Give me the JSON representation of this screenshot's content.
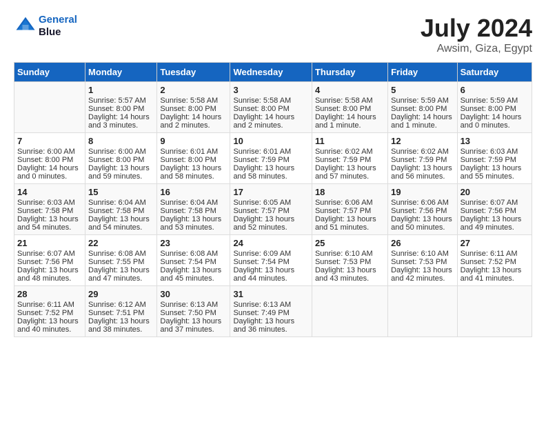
{
  "header": {
    "logo_line1": "General",
    "logo_line2": "Blue",
    "title": "July 2024",
    "subtitle": "Awsim, Giza, Egypt"
  },
  "calendar": {
    "days_of_week": [
      "Sunday",
      "Monday",
      "Tuesday",
      "Wednesday",
      "Thursday",
      "Friday",
      "Saturday"
    ],
    "weeks": [
      [
        {
          "day": "",
          "sunrise": "",
          "sunset": "",
          "daylight": ""
        },
        {
          "day": "1",
          "sunrise": "Sunrise: 5:57 AM",
          "sunset": "Sunset: 8:00 PM",
          "daylight": "Daylight: 14 hours and 3 minutes."
        },
        {
          "day": "2",
          "sunrise": "Sunrise: 5:58 AM",
          "sunset": "Sunset: 8:00 PM",
          "daylight": "Daylight: 14 hours and 2 minutes."
        },
        {
          "day": "3",
          "sunrise": "Sunrise: 5:58 AM",
          "sunset": "Sunset: 8:00 PM",
          "daylight": "Daylight: 14 hours and 2 minutes."
        },
        {
          "day": "4",
          "sunrise": "Sunrise: 5:58 AM",
          "sunset": "Sunset: 8:00 PM",
          "daylight": "Daylight: 14 hours and 1 minute."
        },
        {
          "day": "5",
          "sunrise": "Sunrise: 5:59 AM",
          "sunset": "Sunset: 8:00 PM",
          "daylight": "Daylight: 14 hours and 1 minute."
        },
        {
          "day": "6",
          "sunrise": "Sunrise: 5:59 AM",
          "sunset": "Sunset: 8:00 PM",
          "daylight": "Daylight: 14 hours and 0 minutes."
        }
      ],
      [
        {
          "day": "7",
          "sunrise": "Sunrise: 6:00 AM",
          "sunset": "Sunset: 8:00 PM",
          "daylight": "Daylight: 14 hours and 0 minutes."
        },
        {
          "day": "8",
          "sunrise": "Sunrise: 6:00 AM",
          "sunset": "Sunset: 8:00 PM",
          "daylight": "Daylight: 13 hours and 59 minutes."
        },
        {
          "day": "9",
          "sunrise": "Sunrise: 6:01 AM",
          "sunset": "Sunset: 8:00 PM",
          "daylight": "Daylight: 13 hours and 58 minutes."
        },
        {
          "day": "10",
          "sunrise": "Sunrise: 6:01 AM",
          "sunset": "Sunset: 7:59 PM",
          "daylight": "Daylight: 13 hours and 58 minutes."
        },
        {
          "day": "11",
          "sunrise": "Sunrise: 6:02 AM",
          "sunset": "Sunset: 7:59 PM",
          "daylight": "Daylight: 13 hours and 57 minutes."
        },
        {
          "day": "12",
          "sunrise": "Sunrise: 6:02 AM",
          "sunset": "Sunset: 7:59 PM",
          "daylight": "Daylight: 13 hours and 56 minutes."
        },
        {
          "day": "13",
          "sunrise": "Sunrise: 6:03 AM",
          "sunset": "Sunset: 7:59 PM",
          "daylight": "Daylight: 13 hours and 55 minutes."
        }
      ],
      [
        {
          "day": "14",
          "sunrise": "Sunrise: 6:03 AM",
          "sunset": "Sunset: 7:58 PM",
          "daylight": "Daylight: 13 hours and 54 minutes."
        },
        {
          "day": "15",
          "sunrise": "Sunrise: 6:04 AM",
          "sunset": "Sunset: 7:58 PM",
          "daylight": "Daylight: 13 hours and 54 minutes."
        },
        {
          "day": "16",
          "sunrise": "Sunrise: 6:04 AM",
          "sunset": "Sunset: 7:58 PM",
          "daylight": "Daylight: 13 hours and 53 minutes."
        },
        {
          "day": "17",
          "sunrise": "Sunrise: 6:05 AM",
          "sunset": "Sunset: 7:57 PM",
          "daylight": "Daylight: 13 hours and 52 minutes."
        },
        {
          "day": "18",
          "sunrise": "Sunrise: 6:06 AM",
          "sunset": "Sunset: 7:57 PM",
          "daylight": "Daylight: 13 hours and 51 minutes."
        },
        {
          "day": "19",
          "sunrise": "Sunrise: 6:06 AM",
          "sunset": "Sunset: 7:56 PM",
          "daylight": "Daylight: 13 hours and 50 minutes."
        },
        {
          "day": "20",
          "sunrise": "Sunrise: 6:07 AM",
          "sunset": "Sunset: 7:56 PM",
          "daylight": "Daylight: 13 hours and 49 minutes."
        }
      ],
      [
        {
          "day": "21",
          "sunrise": "Sunrise: 6:07 AM",
          "sunset": "Sunset: 7:56 PM",
          "daylight": "Daylight: 13 hours and 48 minutes."
        },
        {
          "day": "22",
          "sunrise": "Sunrise: 6:08 AM",
          "sunset": "Sunset: 7:55 PM",
          "daylight": "Daylight: 13 hours and 47 minutes."
        },
        {
          "day": "23",
          "sunrise": "Sunrise: 6:08 AM",
          "sunset": "Sunset: 7:54 PM",
          "daylight": "Daylight: 13 hours and 45 minutes."
        },
        {
          "day": "24",
          "sunrise": "Sunrise: 6:09 AM",
          "sunset": "Sunset: 7:54 PM",
          "daylight": "Daylight: 13 hours and 44 minutes."
        },
        {
          "day": "25",
          "sunrise": "Sunrise: 6:10 AM",
          "sunset": "Sunset: 7:53 PM",
          "daylight": "Daylight: 13 hours and 43 minutes."
        },
        {
          "day": "26",
          "sunrise": "Sunrise: 6:10 AM",
          "sunset": "Sunset: 7:53 PM",
          "daylight": "Daylight: 13 hours and 42 minutes."
        },
        {
          "day": "27",
          "sunrise": "Sunrise: 6:11 AM",
          "sunset": "Sunset: 7:52 PM",
          "daylight": "Daylight: 13 hours and 41 minutes."
        }
      ],
      [
        {
          "day": "28",
          "sunrise": "Sunrise: 6:11 AM",
          "sunset": "Sunset: 7:52 PM",
          "daylight": "Daylight: 13 hours and 40 minutes."
        },
        {
          "day": "29",
          "sunrise": "Sunrise: 6:12 AM",
          "sunset": "Sunset: 7:51 PM",
          "daylight": "Daylight: 13 hours and 38 minutes."
        },
        {
          "day": "30",
          "sunrise": "Sunrise: 6:13 AM",
          "sunset": "Sunset: 7:50 PM",
          "daylight": "Daylight: 13 hours and 37 minutes."
        },
        {
          "day": "31",
          "sunrise": "Sunrise: 6:13 AM",
          "sunset": "Sunset: 7:49 PM",
          "daylight": "Daylight: 13 hours and 36 minutes."
        },
        {
          "day": "",
          "sunrise": "",
          "sunset": "",
          "daylight": ""
        },
        {
          "day": "",
          "sunrise": "",
          "sunset": "",
          "daylight": ""
        },
        {
          "day": "",
          "sunrise": "",
          "sunset": "",
          "daylight": ""
        }
      ]
    ]
  }
}
